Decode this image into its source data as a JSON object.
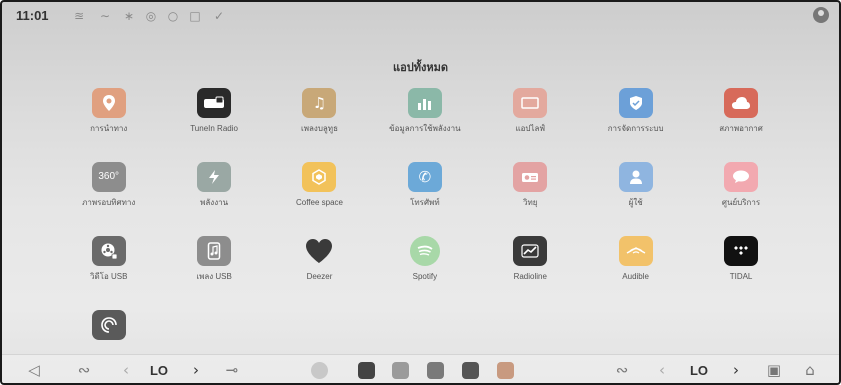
{
  "status_bar": {
    "time": "11:01",
    "icons": [
      "signal-icon",
      "wifi-icon",
      "bluetooth-icon",
      "location-icon",
      "alarm-icon",
      "clock-icon",
      "check-icon"
    ]
  },
  "header": {
    "title": "แอปทั้งหมด"
  },
  "apps": [
    {
      "name": "navigation",
      "label": "การนำทาง",
      "icon": "map-pin-icon",
      "color": "#e0a080"
    },
    {
      "name": "tunein-radio",
      "label": "TuneIn Radio",
      "icon": "radio-icon",
      "color": "#2a2a2a"
    },
    {
      "name": "local-music",
      "label": "เพลงบลูทูธ",
      "icon": "music-icon",
      "color": "#c8a878"
    },
    {
      "name": "energy-data",
      "label": "ข้อมูลการใช้พลังงาน",
      "icon": "bar-chart-icon",
      "color": "#8bb8a8"
    },
    {
      "name": "gallery",
      "label": "แอปไลฟ์",
      "icon": "gallery-icon",
      "color": "#e3a99e"
    },
    {
      "name": "system-settings",
      "label": "การจัดการระบบ",
      "icon": "shield-icon",
      "color": "#6ca0d8"
    },
    {
      "name": "weather",
      "label": "สภาพอากาศ",
      "icon": "cloud-icon",
      "color": "#d76a5a"
    },
    {
      "name": "camera-360",
      "label": "ภาพรอบทิศทาง",
      "icon": "camera-360-icon",
      "color": "#8d8d8d"
    },
    {
      "name": "energy",
      "label": "พลังงาน",
      "icon": "lightning-icon",
      "color": "#9aa8a4"
    },
    {
      "name": "coffee-space",
      "label": "Coffee space",
      "icon": "hexagon-icon",
      "color": "#f2c25a"
    },
    {
      "name": "phone",
      "label": "โทรศัพท์",
      "icon": "phone-icon",
      "color": "#6ca9d8"
    },
    {
      "name": "radio",
      "label": "วิทยุ",
      "icon": "fm-radio-icon",
      "color": "#e3a3a3"
    },
    {
      "name": "user",
      "label": "ผู้ใช้",
      "icon": "user-icon",
      "color": "#8fb5e0"
    },
    {
      "name": "service-center",
      "label": "ศูนย์บริการ",
      "icon": "chat-bubble-icon",
      "color": "#f2a9b0"
    },
    {
      "name": "video-usb",
      "label": "วิดีโอ USB",
      "icon": "video-usb-icon",
      "color": "#6a6a6a"
    },
    {
      "name": "music-usb",
      "label": "เพลง USB",
      "icon": "music-usb-icon",
      "color": "#8d8d8d"
    },
    {
      "name": "deezer",
      "label": "Deezer",
      "icon": "heart-icon",
      "color": "transparent"
    },
    {
      "name": "spotify",
      "label": "Spotify",
      "icon": "spotify-icon",
      "color": "#a8d8a8"
    },
    {
      "name": "radioline",
      "label": "Radioline",
      "icon": "radioline-icon",
      "color": "#3a3a3a"
    },
    {
      "name": "audible",
      "label": "Audible",
      "icon": "audible-icon",
      "color": "#f2c26a"
    },
    {
      "name": "tidal",
      "label": "TIDAL",
      "icon": "tidal-icon",
      "color": "#111111"
    },
    {
      "name": "carplay",
      "label": "",
      "icon": "spiral-icon",
      "color": "#5a5a5a"
    }
  ],
  "bottom_bar": {
    "left_temp": "LO",
    "right_temp": "LO",
    "left_icons": [
      "volume-icon",
      "seat-heat-icon",
      "chevron-left-icon",
      "chevron-right-icon",
      "fan-icon"
    ],
    "right_icons": [
      "seat-heat-right-icon",
      "chevron-left-icon",
      "chevron-right-icon",
      "car-icon",
      "home-icon"
    ],
    "dock_apps": [
      "media-icon",
      "apps-grid-icon",
      "music-app-icon",
      "usb-app-icon",
      "tunein-app-icon",
      "nav-app-icon"
    ]
  }
}
